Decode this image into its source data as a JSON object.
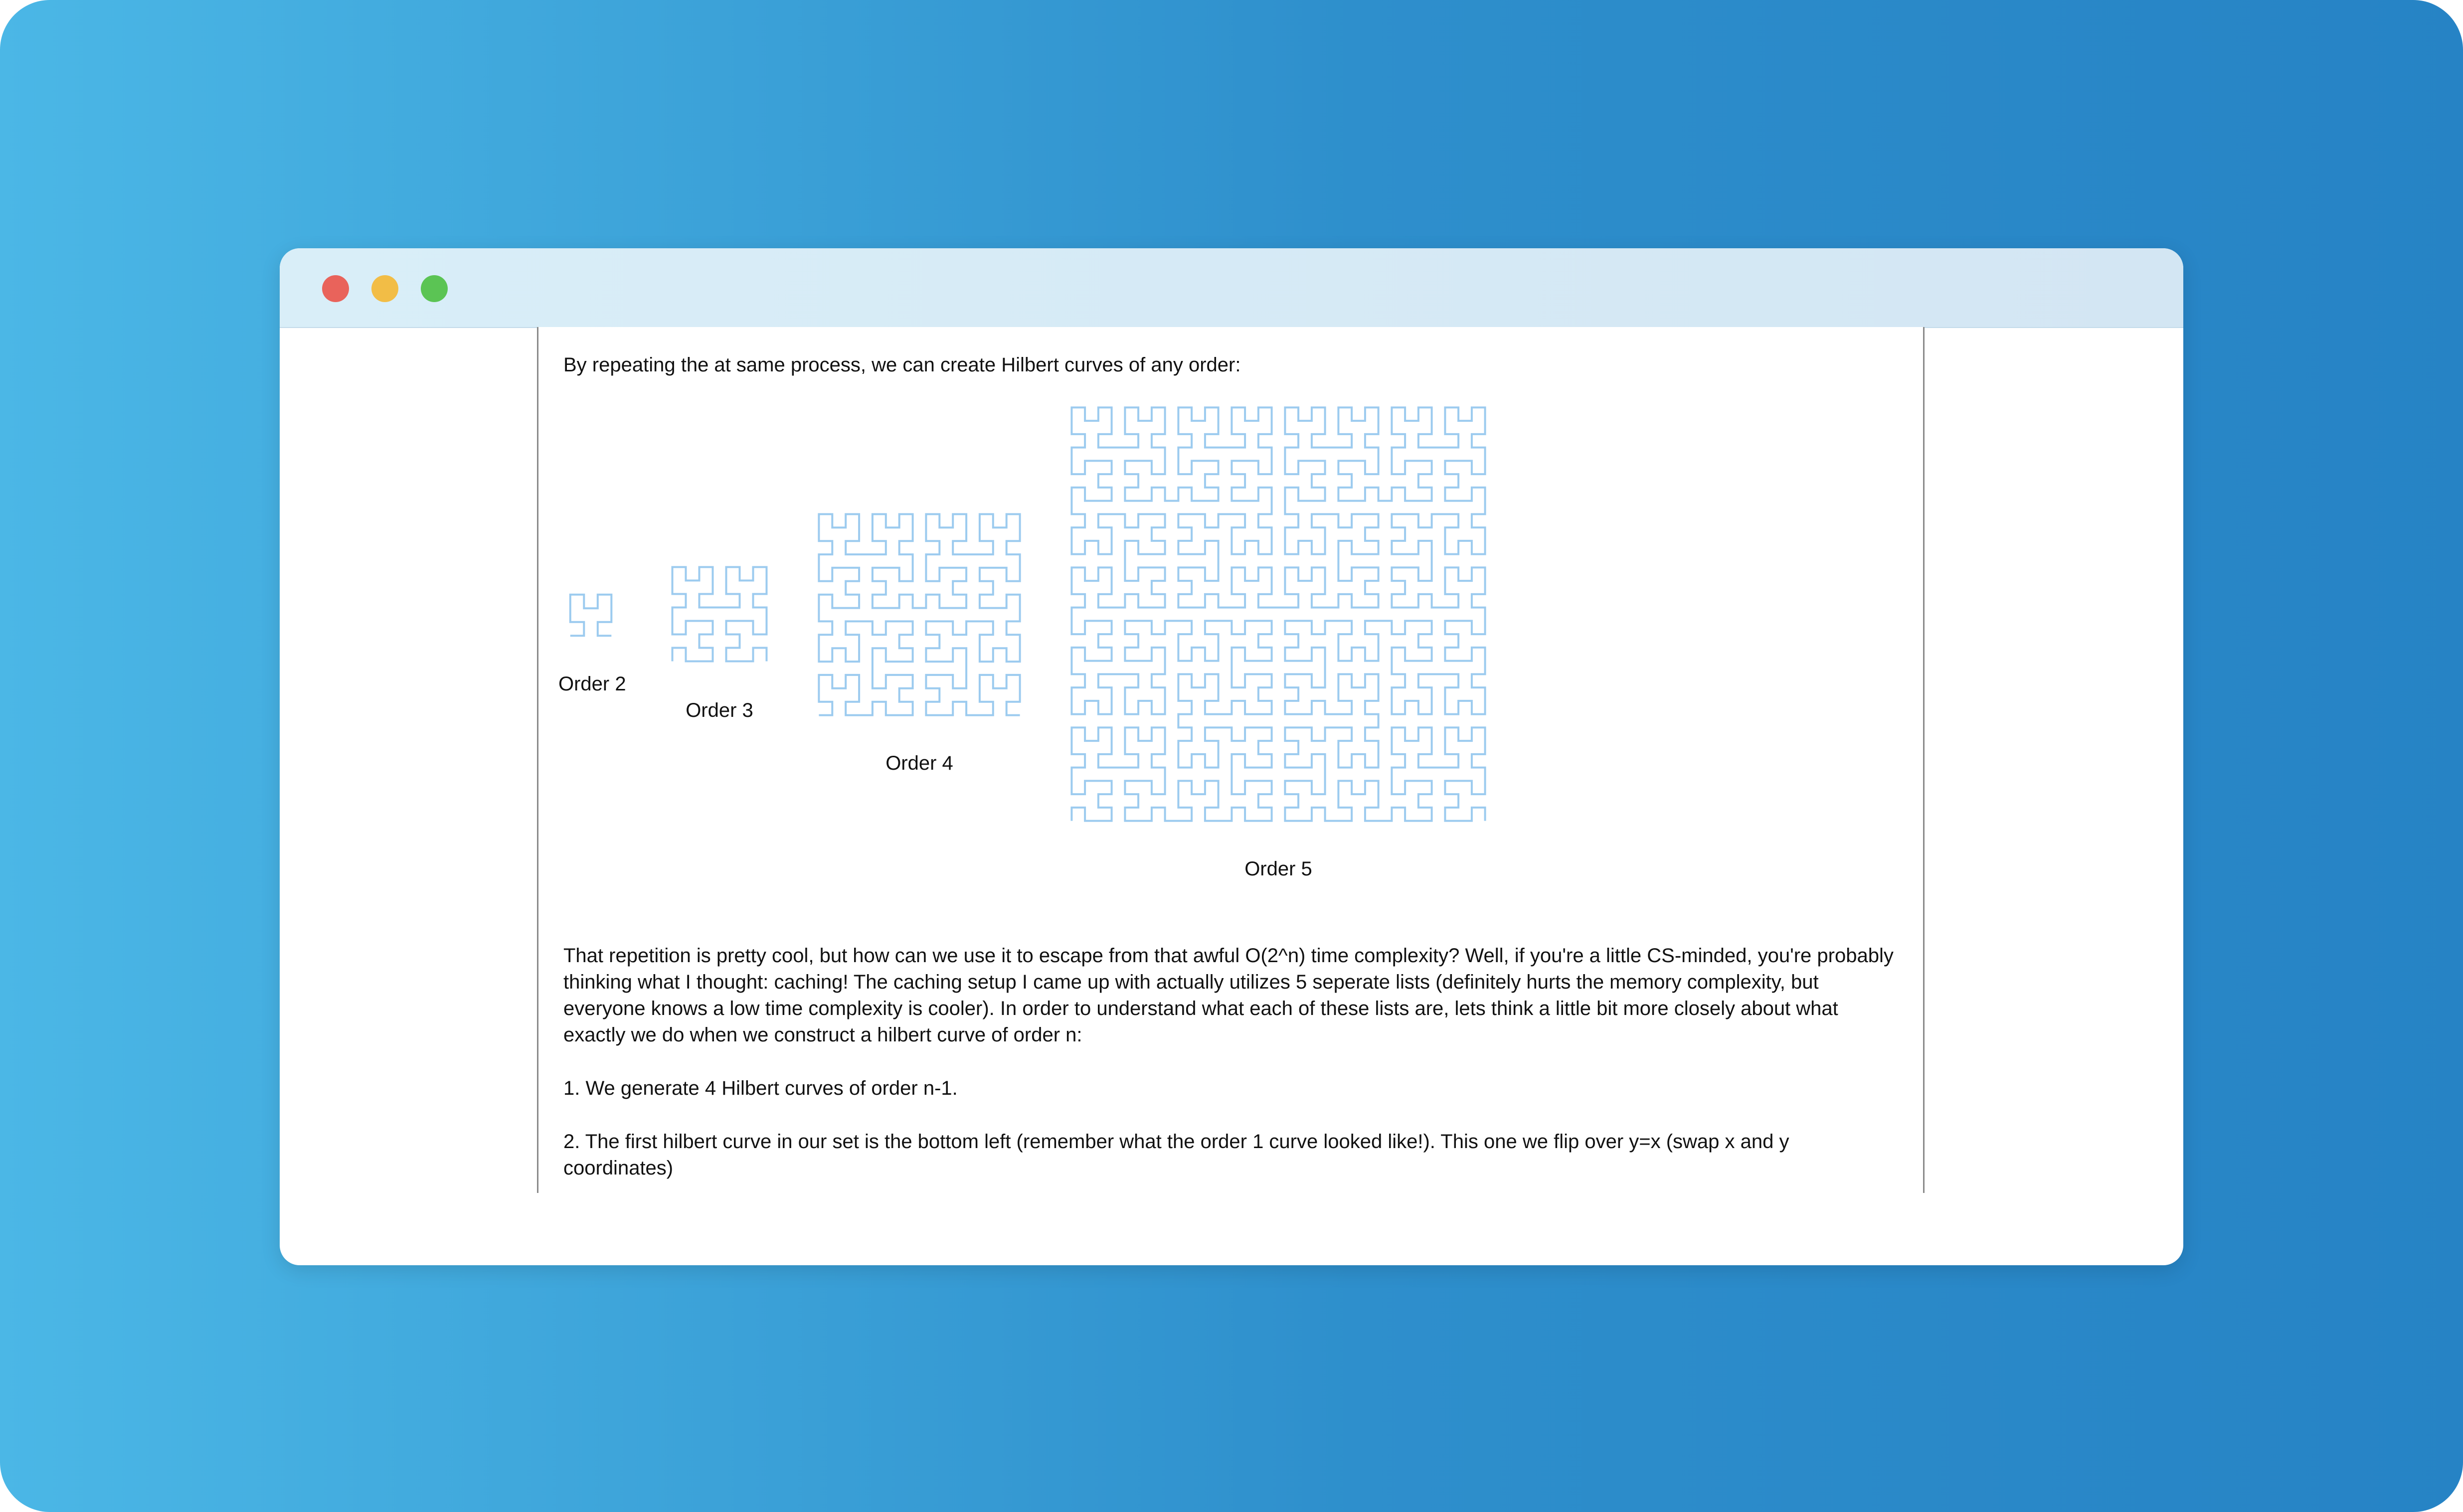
{
  "window": {
    "controls": [
      "close",
      "minimize",
      "maximize"
    ],
    "colors": {
      "close": "#e9635b",
      "minimize": "#f2bd46",
      "maximize": "#5bc454"
    }
  },
  "article": {
    "intro": "By repeating the at same process, we can create Hilbert curves of any order:",
    "figures": [
      {
        "order": 2,
        "caption": "Order 2"
      },
      {
        "order": 3,
        "caption": "Order 3"
      },
      {
        "order": 4,
        "caption": "Order 4"
      },
      {
        "order": 5,
        "caption": "Order 5"
      }
    ],
    "curve_color": "#9ccbef",
    "paragraph": "That repetition is pretty cool, but how can we use it to escape from that awful O(2^n) time complexity? Well, if you're a little CS-minded, you're probably thinking what I thought: caching! The caching setup I came up with actually utilizes 5 seperate lists (definitely hurts the memory complexity, but everyone knows a low time complexity is cooler). In order to understand what each of these lists are, lets think a little bit more closely about what exactly we do when we construct a hilbert curve of order n:",
    "steps": [
      "1. We generate 4 Hilbert curves of order n-1.",
      "2. The first hilbert curve in our set is the bottom left (remember what the order 1 curve looked like!). This one we flip over y=x (swap x and y coordinates)"
    ]
  }
}
